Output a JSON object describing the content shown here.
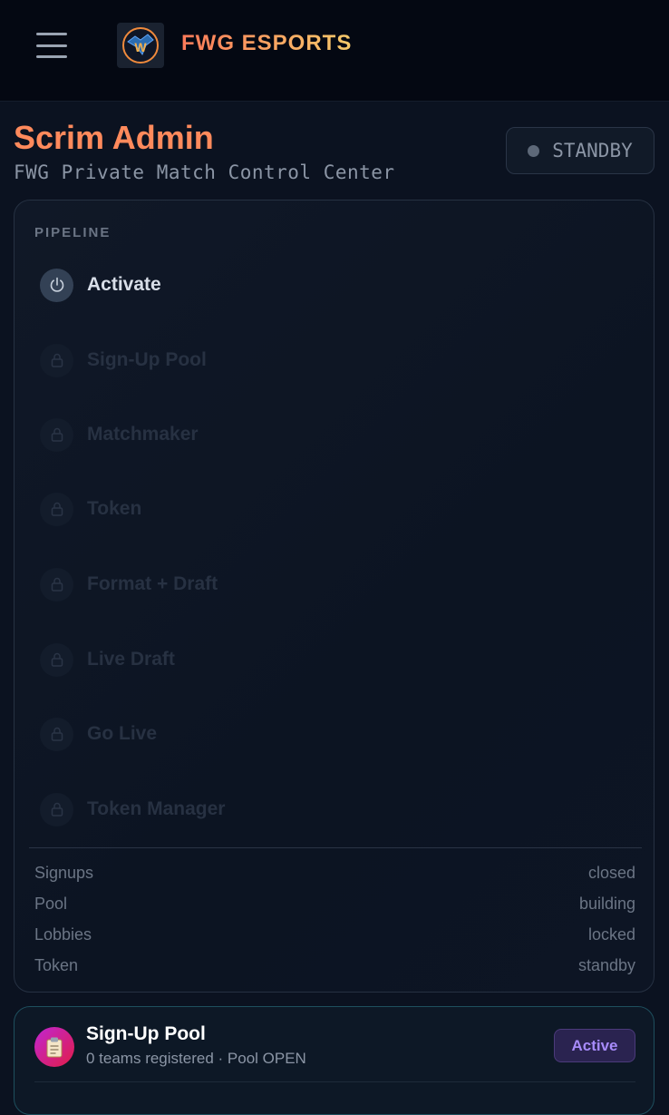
{
  "header": {
    "menu_icon": "hamburger-menu-icon",
    "logo_icon": "fwg-wolf-logo",
    "brand": "FWG ESPORTS"
  },
  "page": {
    "title": "Scrim Admin",
    "subtitle": "FWG Private Match Control Center",
    "status": "STANDBY"
  },
  "pipeline": {
    "label": "PIPELINE",
    "steps": [
      {
        "label": "Activate",
        "state": "active",
        "icon": "power-icon"
      },
      {
        "label": "Sign-Up Pool",
        "state": "locked",
        "icon": "lock-icon"
      },
      {
        "label": "Matchmaker",
        "state": "locked",
        "icon": "lock-icon"
      },
      {
        "label": "Token",
        "state": "locked",
        "icon": "lock-icon"
      },
      {
        "label": "Format + Draft",
        "state": "locked",
        "icon": "lock-icon"
      },
      {
        "label": "Live Draft",
        "state": "locked",
        "icon": "lock-icon"
      },
      {
        "label": "Go Live",
        "state": "locked",
        "icon": "lock-icon"
      },
      {
        "label": "Token Manager",
        "state": "locked",
        "icon": "lock-icon"
      }
    ],
    "stats": [
      {
        "key": "Signups",
        "value": "closed"
      },
      {
        "key": "Pool",
        "value": "building"
      },
      {
        "key": "Lobbies",
        "value": "locked"
      },
      {
        "key": "Token",
        "value": "standby"
      }
    ]
  },
  "signup_card": {
    "icon": "clipboard-icon",
    "title": "Sign-Up Pool",
    "subtitle": "0 teams registered · Pool OPEN",
    "badge": "Active"
  },
  "colors": {
    "accent": "#ff8a5c",
    "badge_purple": "#a78bfa",
    "background": "#0b1220"
  }
}
